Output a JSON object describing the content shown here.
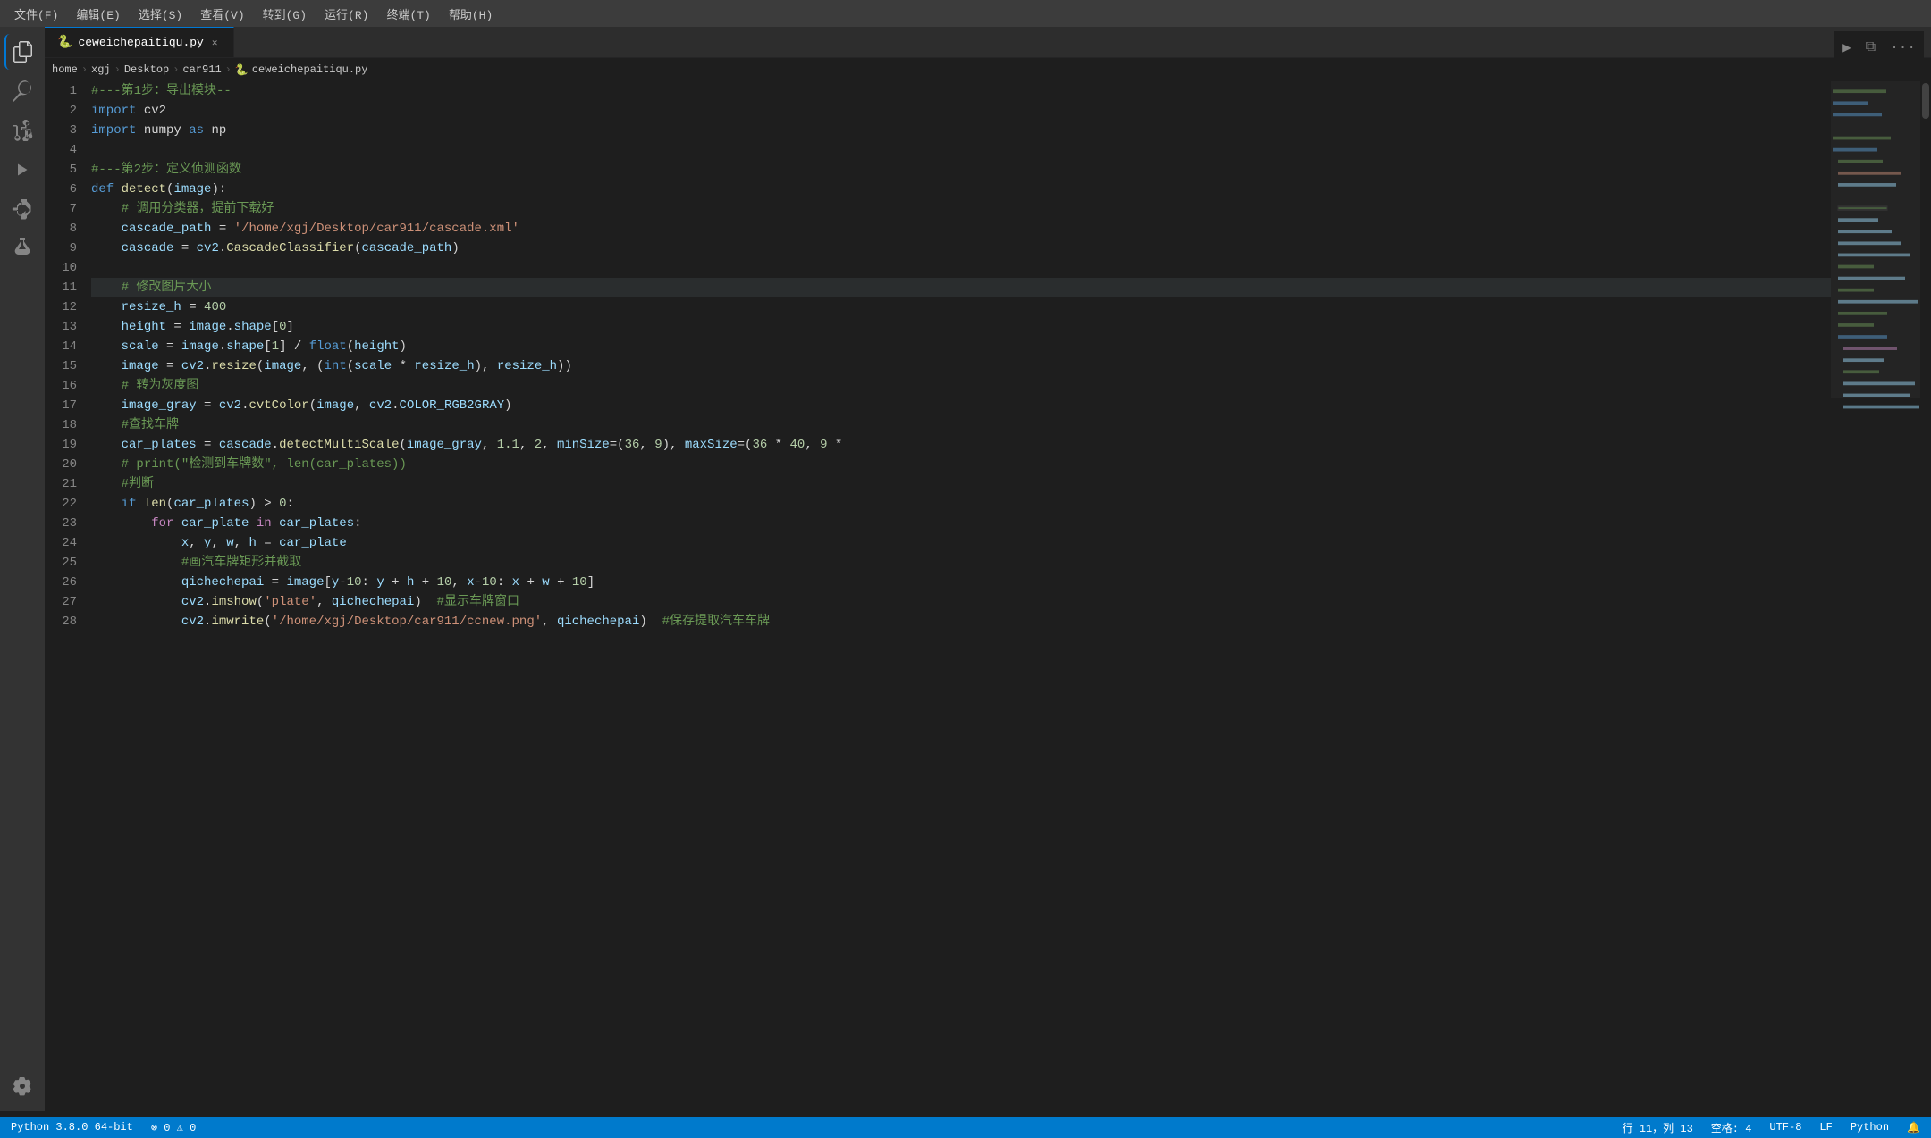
{
  "menubar": {
    "items": [
      {
        "label": "文件(F)"
      },
      {
        "label": "编辑(E)"
      },
      {
        "label": "选择(S)"
      },
      {
        "label": "查看(V)"
      },
      {
        "label": "转到(G)"
      },
      {
        "label": "运行(R)"
      },
      {
        "label": "终端(T)"
      },
      {
        "label": "帮助(H)"
      }
    ]
  },
  "tab": {
    "filename": "ceweichepaitiqu.py",
    "icon": "🐍"
  },
  "breadcrumb": {
    "parts": [
      "home",
      "xgj",
      "Desktop",
      "car911",
      "ceweichepaitiqu.py"
    ]
  },
  "sidebar": {
    "icons": [
      {
        "name": "explorer-icon",
        "symbol": "⎘",
        "active": true
      },
      {
        "name": "search-icon",
        "symbol": "🔍",
        "active": false
      },
      {
        "name": "source-control-icon",
        "symbol": "⑂",
        "active": false
      },
      {
        "name": "run-debug-icon",
        "symbol": "▶",
        "active": false
      },
      {
        "name": "extensions-icon",
        "symbol": "⊞",
        "active": false
      },
      {
        "name": "test-icon",
        "symbol": "⚗",
        "active": false
      }
    ],
    "bottom_icons": [
      {
        "name": "settings-icon",
        "symbol": "⚙",
        "active": false
      }
    ]
  },
  "statusbar": {
    "python_version": "Python 3.8.0 64-bit",
    "errors": "0",
    "warnings": "0",
    "line": "行 11，列 13",
    "spaces": "空格: 4",
    "encoding": "UTF-8",
    "line_ending": "LF",
    "language": "Python",
    "bell_icon": "🔔"
  },
  "toolbar": {
    "run_label": "▶",
    "split_label": "⧉",
    "more_label": "···"
  },
  "lines": [
    {
      "num": 1,
      "content": "#---第1步：导出模块--",
      "type": "comment"
    },
    {
      "num": 2,
      "content": "import cv2",
      "type": "code"
    },
    {
      "num": 3,
      "content": "import numpy as np",
      "type": "code"
    },
    {
      "num": 4,
      "content": "",
      "type": "empty"
    },
    {
      "num": 5,
      "content": "#---第2步：定义侦测函数",
      "type": "comment"
    },
    {
      "num": 6,
      "content": "def detect(image):",
      "type": "code"
    },
    {
      "num": 7,
      "content": "    # 调用分类器，提前下载好",
      "type": "comment"
    },
    {
      "num": 8,
      "content": "    cascade_path = '/home/xgj/Desktop/car911/cascade.xml'",
      "type": "code"
    },
    {
      "num": 9,
      "content": "    cascade = cv2.CascadeClassifier(cascade_path)",
      "type": "code"
    },
    {
      "num": 10,
      "content": "",
      "type": "empty"
    },
    {
      "num": 11,
      "content": "    # 修改图片大小",
      "type": "comment_highlighted"
    },
    {
      "num": 12,
      "content": "    resize_h = 400",
      "type": "code"
    },
    {
      "num": 13,
      "content": "    height = image.shape[0]",
      "type": "code"
    },
    {
      "num": 14,
      "content": "    scale = image.shape[1] / float(height)",
      "type": "code"
    },
    {
      "num": 15,
      "content": "    image = cv2.resize(image, (int(scale * resize_h), resize_h))",
      "type": "code"
    },
    {
      "num": 16,
      "content": "    # 转为灰度图",
      "type": "comment"
    },
    {
      "num": 17,
      "content": "    image_gray = cv2.cvtColor(image, cv2.COLOR_RGB2GRAY)",
      "type": "code"
    },
    {
      "num": 18,
      "content": "    #查找车牌",
      "type": "comment"
    },
    {
      "num": 19,
      "content": "    car_plates = cascade.detectMultiScale(image_gray, 1.1, 2, minSize=(36, 9), maxSize=(36 * 40, 9 *",
      "type": "code"
    },
    {
      "num": 20,
      "content": "    # print(\"检测到车牌数\", len(car_plates))",
      "type": "comment"
    },
    {
      "num": 21,
      "content": "    #判断",
      "type": "comment"
    },
    {
      "num": 22,
      "content": "    if len(car_plates) > 0:",
      "type": "code"
    },
    {
      "num": 23,
      "content": "        for car_plate in car_plates:",
      "type": "code"
    },
    {
      "num": 24,
      "content": "            x, y, w, h = car_plate",
      "type": "code"
    },
    {
      "num": 25,
      "content": "            #画汽车牌矩形并截取",
      "type": "comment"
    },
    {
      "num": 26,
      "content": "            qichechepai = image[y-10: y + h + 10, x-10: x + w + 10]",
      "type": "code"
    },
    {
      "num": 27,
      "content": "            cv2.imshow('plate', qichechepai)  #显示车牌窗口",
      "type": "code"
    },
    {
      "num": 28,
      "content": "            cv2.imwrite('/home/xgj/Desktop/car911/ccnew.png', qichechepai)  #保存提取汽车车牌",
      "type": "code"
    }
  ]
}
